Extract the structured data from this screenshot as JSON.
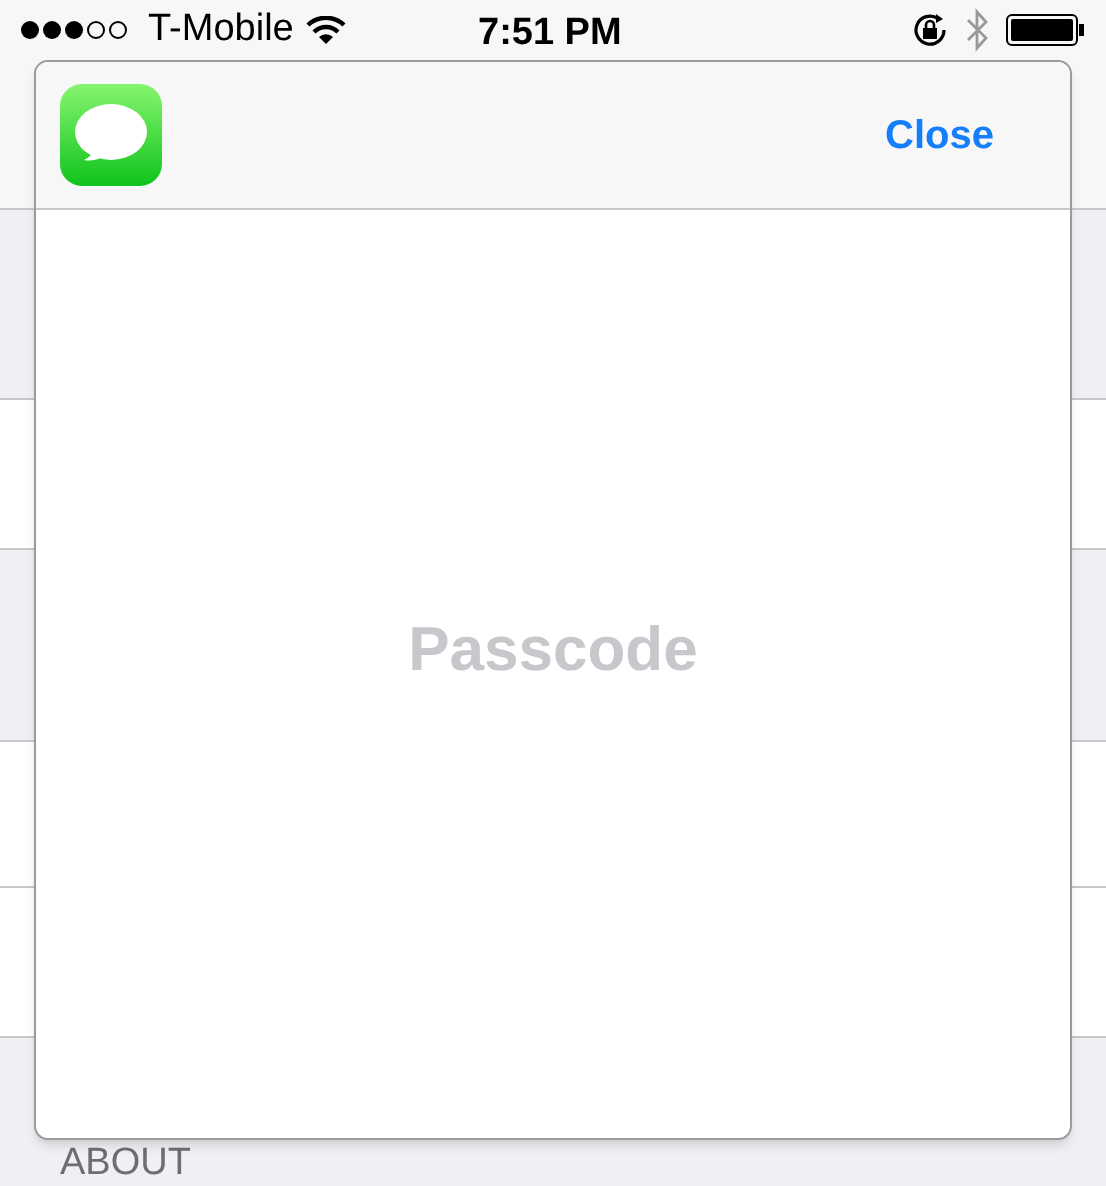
{
  "status_bar": {
    "carrier": "T-Mobile",
    "time": "7:51 PM"
  },
  "sheet": {
    "close_label": "Close",
    "message": "Passcode"
  },
  "background": {
    "section_header": "ABOUT"
  }
}
